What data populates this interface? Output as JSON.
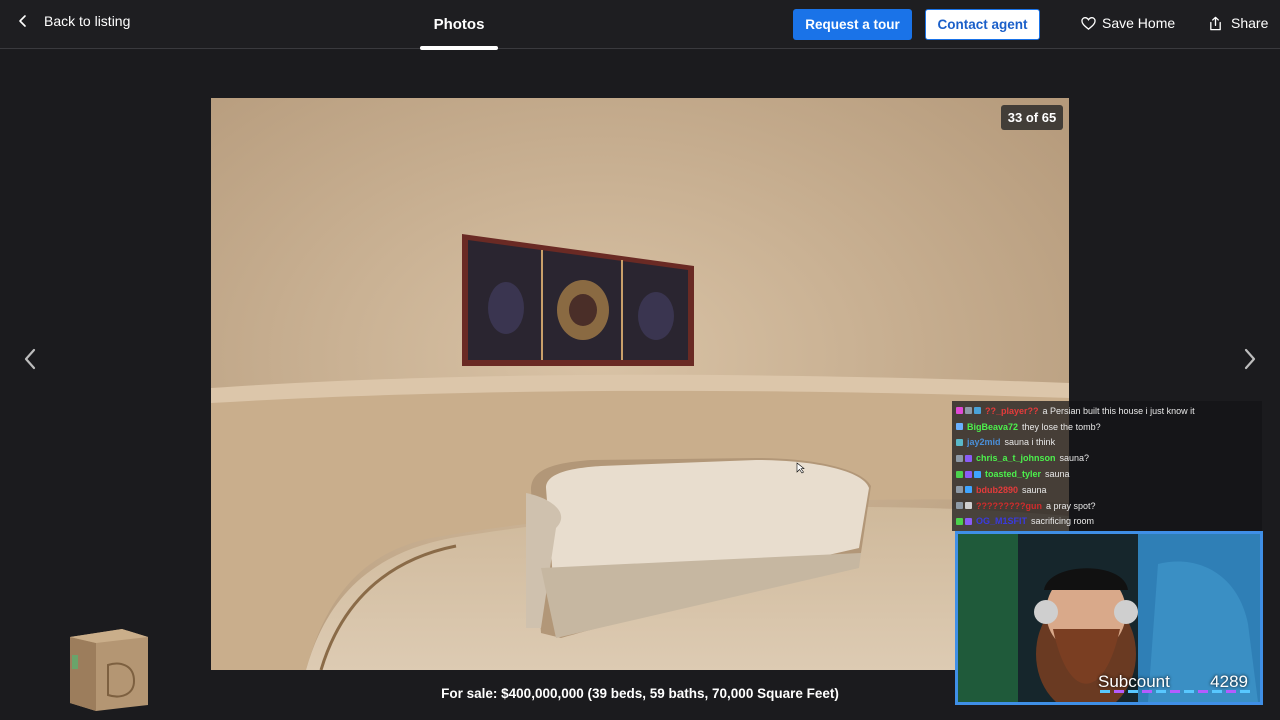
{
  "header": {
    "back_label": "Back to listing",
    "tab_label": "Photos",
    "request_tour_label": "Request a tour",
    "contact_agent_label": "Contact agent",
    "save_home_label": "Save Home",
    "share_label": "Share"
  },
  "gallery": {
    "counter": "33 of 65",
    "caption": "For sale: $400,000,000 (39 beds, 59 baths, 70,000 Square Feet)"
  },
  "chat": [
    {
      "user": "??_player??",
      "user_color": "#e33b3b",
      "badges": [
        "#e24ad6",
        "#8e9aa6",
        "#4aa3d8"
      ],
      "message": "a Persian built this house i just know it"
    },
    {
      "user": "BigBeava72",
      "user_color": "#4cf04c",
      "badges": [
        "#6ab0ff"
      ],
      "message": "they lose the tomb?"
    },
    {
      "user": "jay2mid",
      "user_color": "#4a8fd8",
      "badges": [
        "#5ab9c9"
      ],
      "message": "sauna i think"
    },
    {
      "user": "chris_a_t_johnson",
      "user_color": "#4cf04c",
      "badges": [
        "#8e9aa6",
        "#8a5cf6"
      ],
      "message": "sauna?"
    },
    {
      "user": "toasted_tyler",
      "user_color": "#4cf04c",
      "badges": [
        "#4cd24c",
        "#8a5cf6",
        "#3fa5ff"
      ],
      "message": "sauna"
    },
    {
      "user": "bdub2890",
      "user_color": "#e33b3b",
      "badges": [
        "#8e9aa6",
        "#3fa5ff"
      ],
      "message": "sauna"
    },
    {
      "user": "?????????gun",
      "user_color": "#d02c2c",
      "badges": [
        "#8e9aa6",
        "#cfcfcf"
      ],
      "message": "a pray spot?"
    },
    {
      "user": "OG_M1SFIT",
      "user_color": "#3a3adf",
      "badges": [
        "#4cd24c",
        "#8a5cf6"
      ],
      "message": "sacrificing room"
    }
  ],
  "overlay": {
    "subcount_label": "Subcount",
    "subcount_value": "4289"
  },
  "colors": {
    "accent_blue": "#1a73e8",
    "background": "#1b1b1e",
    "cam_border": "#3f8fe6"
  }
}
